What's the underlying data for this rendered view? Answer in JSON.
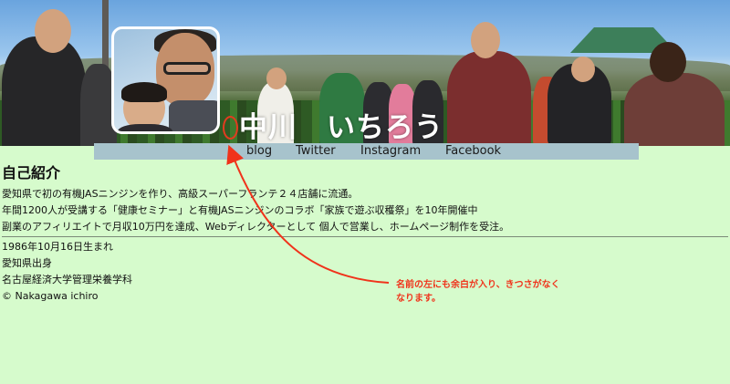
{
  "header": {
    "site_title": "中川　いちろう"
  },
  "nav": {
    "items": [
      {
        "label": "blog"
      },
      {
        "label": "Twitter"
      },
      {
        "label": "Instagram"
      },
      {
        "label": "Facebook"
      }
    ]
  },
  "about": {
    "heading": "自己紹介",
    "intro": [
      "愛知県で初の有機JASニンジンを作り、高級スーパーフランテ２４店舗に流通。",
      "年間1200人が受講する「健康セミナー」と有機JASニンジンのコラボ「家族で遊ぶ収穫祭」を10年開催中",
      "副業のアフィリエイトで月収10万円を達成、Webディレクターとして 個人で営業し、ホームページ制作を受注。"
    ],
    "facts": [
      "1986年10月16日生まれ",
      "愛知県出身",
      "名古屋経済大学管理栄養学科"
    ],
    "copyright": "© Nakagawa ichiro"
  },
  "annotation": {
    "line1": "名前の左にも余白が入り、きつさがなく",
    "line2": "なります。",
    "color": "#f0331b"
  },
  "colors": {
    "page_background": "#d6fbcc",
    "nav_background": "#a7c3cc",
    "title_text": "#ffffff"
  }
}
